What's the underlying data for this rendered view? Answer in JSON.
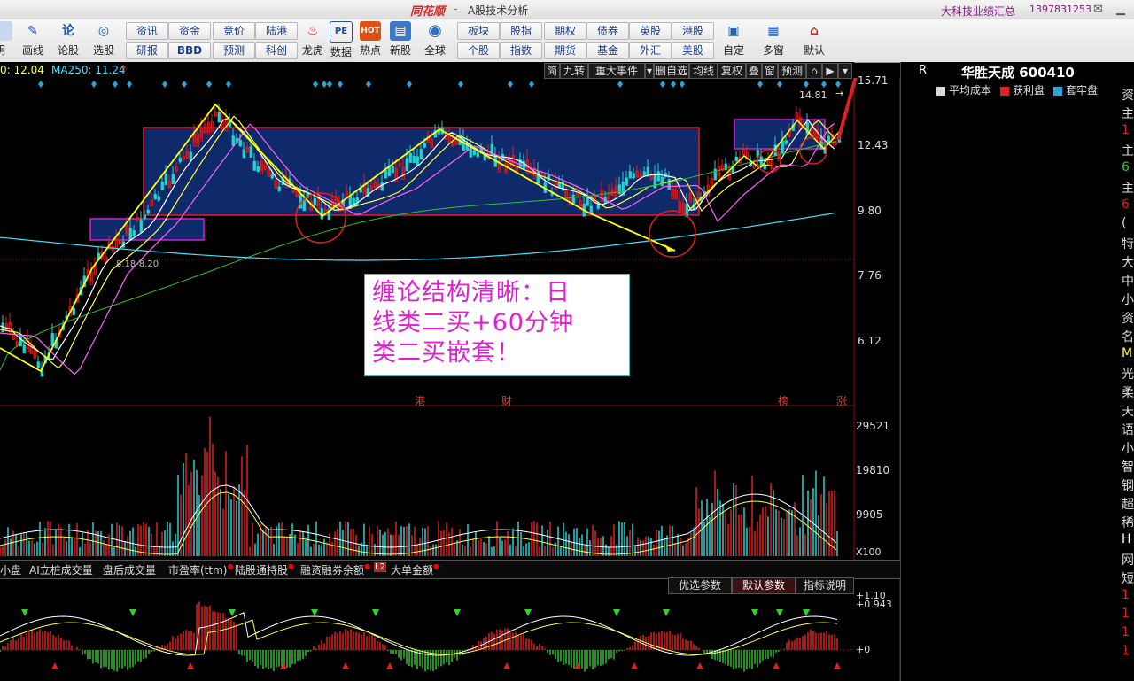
{
  "titlebar": {
    "logo": "同花顺",
    "separator": "-",
    "window_title": "A股技术分析",
    "notice": "大科技业绩汇总",
    "phone": "1397831253"
  },
  "toolbar": {
    "big_buttons": [
      {
        "label": "画线",
        "icon": "pen-icon"
      },
      {
        "label": "论股",
        "icon": "lun-icon"
      },
      {
        "label": "选股",
        "icon": "stock-pick-icon"
      },
      {
        "label": "龙虎",
        "icon": "dragon-tiger-icon"
      },
      {
        "label": "数据",
        "icon": "pe-data-icon"
      },
      {
        "label": "热点",
        "icon": "hot-icon"
      },
      {
        "label": "新股",
        "icon": "new-stock-icon"
      },
      {
        "label": "全球",
        "icon": "globe-icon"
      },
      {
        "label": "自定",
        "icon": "custom-icon"
      },
      {
        "label": "多窗",
        "icon": "multi-window-icon"
      },
      {
        "label": "默认",
        "icon": "home-icon"
      }
    ],
    "small_top": [
      "资讯",
      "资金",
      "竞价",
      "陆港",
      "板块",
      "股指",
      "期权",
      "债券",
      "英股",
      "港股"
    ],
    "small_bottom": [
      "研报",
      "BBD",
      "预测",
      "科创",
      "个股",
      "指数",
      "期货",
      "基金",
      "外汇",
      "美股"
    ],
    "left_cut_label": "明"
  },
  "chart_header": {
    "ma_left": "0: 12.04",
    "ma250": "MA250: 11.24",
    "buttons": [
      "简",
      "九转",
      "重大事件",
      "删自选",
      "均线",
      "复权",
      "叠",
      "窗",
      "预测"
    ]
  },
  "price_axis": [
    "15.71",
    "12.43",
    "9.80",
    "7.76",
    "6.12"
  ],
  "price_marks": {
    "high": "14.81",
    "low_range": "8.18-8.20"
  },
  "event_marks": [
    "港",
    "财",
    "榜",
    "涨"
  ],
  "annotation": {
    "lines": [
      "缠论结构清晰：日",
      "线类二买+60分钟",
      "类二买嵌套！"
    ]
  },
  "volume_axis": [
    "29521",
    "19810",
    "9905",
    "X100"
  ],
  "right_panel": {
    "r_label": "R",
    "stock_name": "华胜天成 600410",
    "legend": [
      {
        "label": "平均成本",
        "color": "#d8d8d8"
      },
      {
        "label": "获利盘",
        "color": "#e02020"
      },
      {
        "label": "套牢盘",
        "color": "#2aa3d8"
      }
    ],
    "edge_chars": [
      "资",
      "主",
      "1",
      "主",
      "6",
      "主",
      "6",
      "(",
      "特",
      "大",
      "中",
      "小",
      "资",
      "名",
      "M",
      "光",
      "柔",
      "天",
      "语",
      "小",
      "智",
      "钢",
      "超",
      "稀",
      "H",
      "网",
      "短",
      "1",
      "1",
      "1",
      "1"
    ]
  },
  "indicator_tabs": [
    "小盘",
    "AI立桩成交量",
    "盘后成交量",
    "市盈率(ttm)",
    "陆股通持股",
    "融资融券余额",
    "大单金额"
  ],
  "indicator_tab_badge": "L2",
  "sub_buttons": [
    "优选参数",
    "默认参数",
    "指标说明"
  ],
  "macd_axis": [
    "+1.10",
    "+0.943",
    "+0"
  ],
  "colors": {
    "up": "#e02020",
    "down": "#2ad0d0",
    "box_fill": "#0f2a6a",
    "box_border": "#e02020",
    "annotation_text": "#e020d0",
    "arrow": "#ffff00"
  }
}
